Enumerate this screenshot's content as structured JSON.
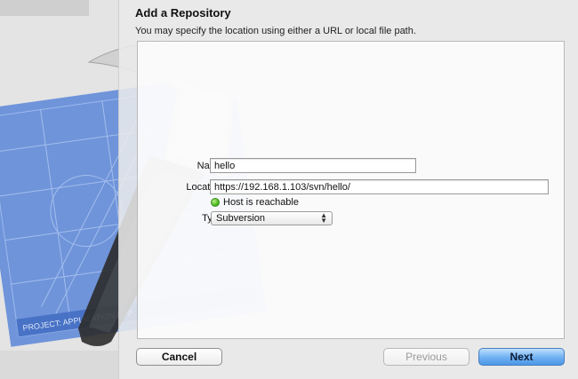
{
  "dialog": {
    "title": "Add a Repository",
    "subtitle": "You may specify the location using either a URL or local file path."
  },
  "form": {
    "name_label": "Name",
    "name_value": "hello",
    "location_label": "Location",
    "location_value": "https://192.168.1.103/svn/hello/",
    "status_text": "Host is reachable",
    "type_label": "Type",
    "type_value": "Subversion"
  },
  "buttons": {
    "cancel": "Cancel",
    "previous": "Previous",
    "next": "Next"
  },
  "background": {
    "blueprint_text": "PROJECT: APPLICATION APP"
  },
  "colors": {
    "accent": "#4d97e6",
    "status_ok": "#4cb820",
    "blueprint": "#5b86d8"
  },
  "icons": {
    "status": "green-dot-icon",
    "type_select": "updown-arrows-icon",
    "background": "xcode-hammer-blueprint-icon"
  }
}
